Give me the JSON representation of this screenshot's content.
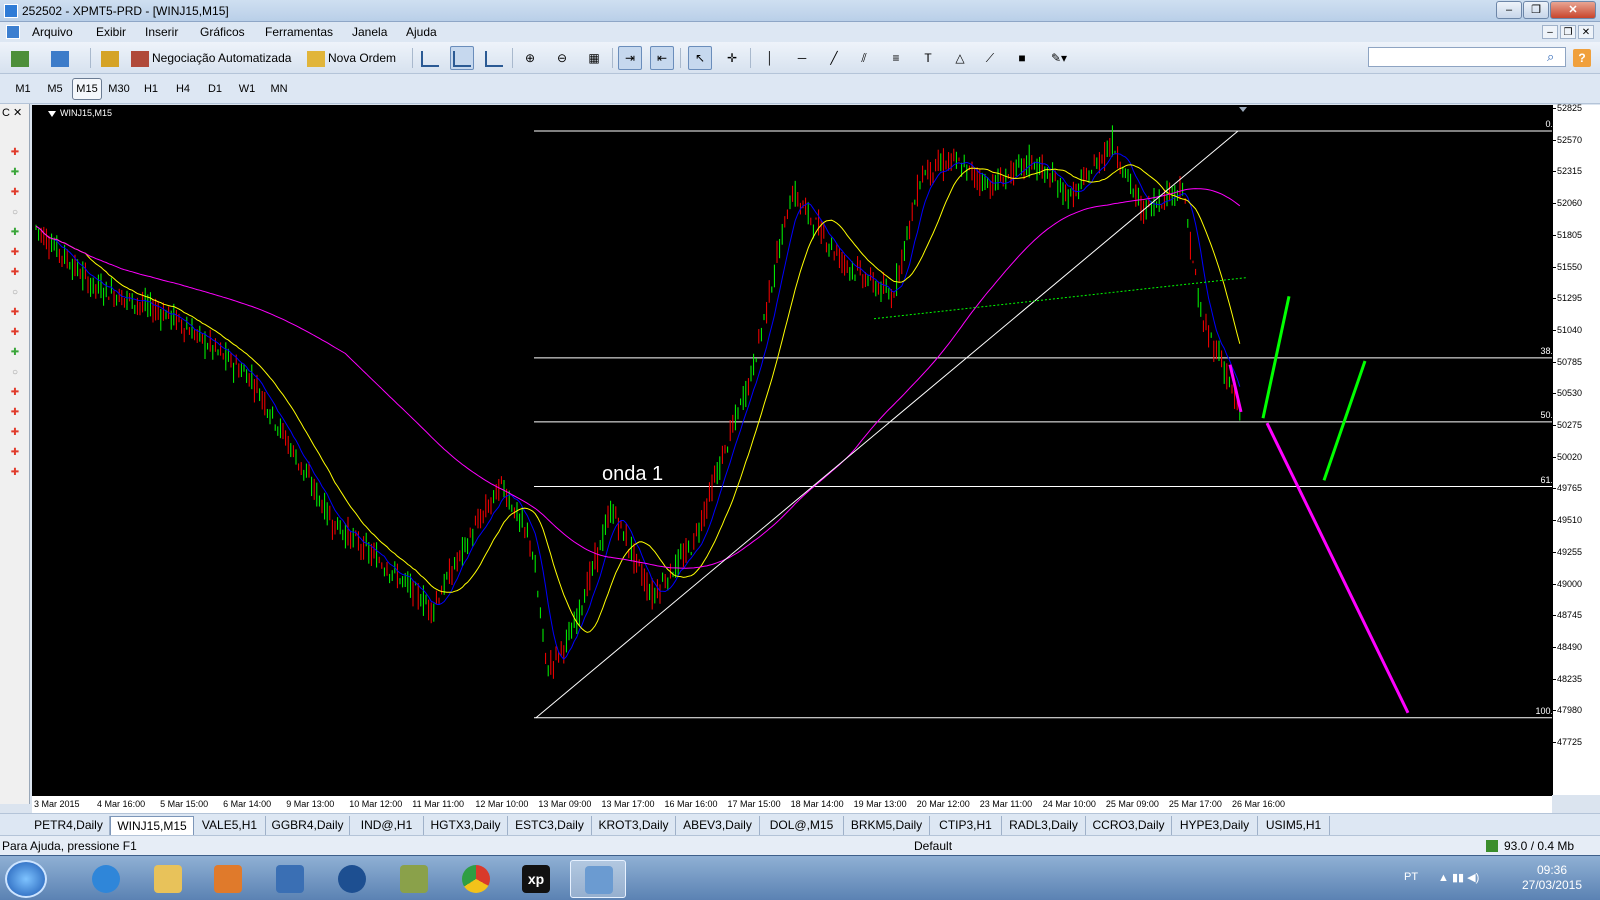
{
  "window": {
    "title": "252502 - XPMT5-PRD - [WINJ15,M15]"
  },
  "menu": [
    "Arquivo",
    "Exibir",
    "Inserir",
    "Gráficos",
    "Ferramentas",
    "Janela",
    "Ajuda"
  ],
  "toolbar": {
    "auto_trading": "Negociação Automatizada",
    "new_order": "Nova Ordem"
  },
  "timeframes": [
    "M1",
    "M5",
    "M15",
    "M30",
    "H1",
    "H4",
    "D1",
    "W1",
    "MN"
  ],
  "active_timeframe": "M15",
  "chart": {
    "symbol_label": "WINJ15,M15",
    "annotation": "onda 1",
    "price_axis": [
      "52825",
      "52570",
      "52315",
      "52060",
      "51805",
      "51550",
      "51295",
      "51040",
      "50785",
      "50530",
      "50275",
      "50020",
      "49765",
      "49510",
      "49255",
      "49000",
      "48745",
      "48490",
      "48235",
      "47980",
      "47725"
    ],
    "time_axis": [
      "3 Mar 2015",
      "4 Mar 16:00",
      "5 Mar 15:00",
      "6 Mar 14:00",
      "9 Mar 13:00",
      "10 Mar 12:00",
      "11 Mar 11:00",
      "12 Mar 10:00",
      "13 Mar 09:00",
      "13 Mar 17:00",
      "16 Mar 16:00",
      "17 Mar 15:00",
      "18 Mar 14:00",
      "19 Mar 13:00",
      "20 Mar 12:00",
      "23 Mar 11:00",
      "24 Mar 10:00",
      "25 Mar 09:00",
      "25 Mar 17:00",
      "26 Mar 16:00"
    ],
    "fib_levels": [
      {
        "label": "0.0",
        "price": 52640
      },
      {
        "label": "38.2",
        "price": 50815
      },
      {
        "label": "50.0",
        "price": 50300
      },
      {
        "label": "61.8",
        "price": 49780
      },
      {
        "label": "100.0",
        "price": 47920
      }
    ],
    "colors": {
      "background": "#000000",
      "ma_fast": "#0000ff",
      "ma_mid": "#ffff00",
      "ma_slow": "#ff00ff",
      "bull": "#00ff00",
      "bear": "#ff0000",
      "projection_up": "#00ff00",
      "projection_down": "#ff00ff"
    }
  },
  "symbol_tabs": [
    "PETR4,Daily",
    "WINJ15,M15",
    "VALE5,H1",
    "GGBR4,Daily",
    "IND@,H1",
    "HGTX3,Daily",
    "ESTC3,Daily",
    "KROT3,Daily",
    "ABEV3,Daily",
    "DOL@,M15",
    "BRKM5,Daily",
    "CTIP3,H1",
    "RADL3,Daily",
    "CCRO3,Daily",
    "HYPE3,Daily",
    "USIM5,H1"
  ],
  "active_tab": "WINJ15,M15",
  "status": {
    "help": "Para Ajuda, pressione F1",
    "profile": "Default",
    "connection": "93.0 / 0.4 Mb"
  },
  "taskbar": {
    "language": "PT",
    "time": "09:36",
    "date": "27/03/2015"
  },
  "icons": [
    "app-icon",
    "search-icon",
    "help-icon",
    "start-orb-icon",
    "ie-icon",
    "explorer-icon",
    "media-icon",
    "chrome-icon",
    "xp-icon",
    "metatrader-icon"
  ]
}
